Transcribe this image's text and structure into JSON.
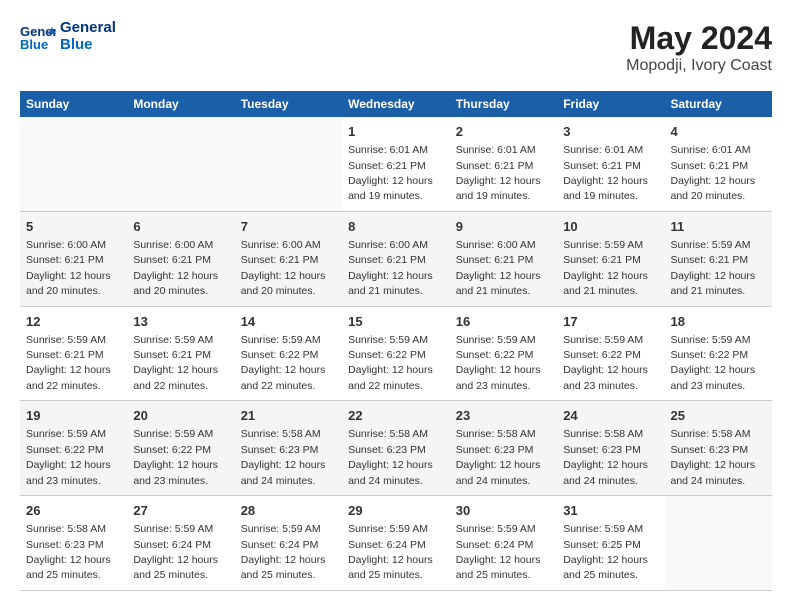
{
  "header": {
    "logo_line1": "General",
    "logo_line2": "Blue",
    "title": "May 2024",
    "subtitle": "Mopodji, Ivory Coast"
  },
  "days_of_week": [
    "Sunday",
    "Monday",
    "Tuesday",
    "Wednesday",
    "Thursday",
    "Friday",
    "Saturday"
  ],
  "weeks": [
    [
      {
        "day": "",
        "info": ""
      },
      {
        "day": "",
        "info": ""
      },
      {
        "day": "",
        "info": ""
      },
      {
        "day": "1",
        "info": "Sunrise: 6:01 AM\nSunset: 6:21 PM\nDaylight: 12 hours\nand 19 minutes."
      },
      {
        "day": "2",
        "info": "Sunrise: 6:01 AM\nSunset: 6:21 PM\nDaylight: 12 hours\nand 19 minutes."
      },
      {
        "day": "3",
        "info": "Sunrise: 6:01 AM\nSunset: 6:21 PM\nDaylight: 12 hours\nand 19 minutes."
      },
      {
        "day": "4",
        "info": "Sunrise: 6:01 AM\nSunset: 6:21 PM\nDaylight: 12 hours\nand 20 minutes."
      }
    ],
    [
      {
        "day": "5",
        "info": "Sunrise: 6:00 AM\nSunset: 6:21 PM\nDaylight: 12 hours\nand 20 minutes."
      },
      {
        "day": "6",
        "info": "Sunrise: 6:00 AM\nSunset: 6:21 PM\nDaylight: 12 hours\nand 20 minutes."
      },
      {
        "day": "7",
        "info": "Sunrise: 6:00 AM\nSunset: 6:21 PM\nDaylight: 12 hours\nand 20 minutes."
      },
      {
        "day": "8",
        "info": "Sunrise: 6:00 AM\nSunset: 6:21 PM\nDaylight: 12 hours\nand 21 minutes."
      },
      {
        "day": "9",
        "info": "Sunrise: 6:00 AM\nSunset: 6:21 PM\nDaylight: 12 hours\nand 21 minutes."
      },
      {
        "day": "10",
        "info": "Sunrise: 5:59 AM\nSunset: 6:21 PM\nDaylight: 12 hours\nand 21 minutes."
      },
      {
        "day": "11",
        "info": "Sunrise: 5:59 AM\nSunset: 6:21 PM\nDaylight: 12 hours\nand 21 minutes."
      }
    ],
    [
      {
        "day": "12",
        "info": "Sunrise: 5:59 AM\nSunset: 6:21 PM\nDaylight: 12 hours\nand 22 minutes."
      },
      {
        "day": "13",
        "info": "Sunrise: 5:59 AM\nSunset: 6:21 PM\nDaylight: 12 hours\nand 22 minutes."
      },
      {
        "day": "14",
        "info": "Sunrise: 5:59 AM\nSunset: 6:22 PM\nDaylight: 12 hours\nand 22 minutes."
      },
      {
        "day": "15",
        "info": "Sunrise: 5:59 AM\nSunset: 6:22 PM\nDaylight: 12 hours\nand 22 minutes."
      },
      {
        "day": "16",
        "info": "Sunrise: 5:59 AM\nSunset: 6:22 PM\nDaylight: 12 hours\nand 23 minutes."
      },
      {
        "day": "17",
        "info": "Sunrise: 5:59 AM\nSunset: 6:22 PM\nDaylight: 12 hours\nand 23 minutes."
      },
      {
        "day": "18",
        "info": "Sunrise: 5:59 AM\nSunset: 6:22 PM\nDaylight: 12 hours\nand 23 minutes."
      }
    ],
    [
      {
        "day": "19",
        "info": "Sunrise: 5:59 AM\nSunset: 6:22 PM\nDaylight: 12 hours\nand 23 minutes."
      },
      {
        "day": "20",
        "info": "Sunrise: 5:59 AM\nSunset: 6:22 PM\nDaylight: 12 hours\nand 23 minutes."
      },
      {
        "day": "21",
        "info": "Sunrise: 5:58 AM\nSunset: 6:23 PM\nDaylight: 12 hours\nand 24 minutes."
      },
      {
        "day": "22",
        "info": "Sunrise: 5:58 AM\nSunset: 6:23 PM\nDaylight: 12 hours\nand 24 minutes."
      },
      {
        "day": "23",
        "info": "Sunrise: 5:58 AM\nSunset: 6:23 PM\nDaylight: 12 hours\nand 24 minutes."
      },
      {
        "day": "24",
        "info": "Sunrise: 5:58 AM\nSunset: 6:23 PM\nDaylight: 12 hours\nand 24 minutes."
      },
      {
        "day": "25",
        "info": "Sunrise: 5:58 AM\nSunset: 6:23 PM\nDaylight: 12 hours\nand 24 minutes."
      }
    ],
    [
      {
        "day": "26",
        "info": "Sunrise: 5:58 AM\nSunset: 6:23 PM\nDaylight: 12 hours\nand 25 minutes."
      },
      {
        "day": "27",
        "info": "Sunrise: 5:59 AM\nSunset: 6:24 PM\nDaylight: 12 hours\nand 25 minutes."
      },
      {
        "day": "28",
        "info": "Sunrise: 5:59 AM\nSunset: 6:24 PM\nDaylight: 12 hours\nand 25 minutes."
      },
      {
        "day": "29",
        "info": "Sunrise: 5:59 AM\nSunset: 6:24 PM\nDaylight: 12 hours\nand 25 minutes."
      },
      {
        "day": "30",
        "info": "Sunrise: 5:59 AM\nSunset: 6:24 PM\nDaylight: 12 hours\nand 25 minutes."
      },
      {
        "day": "31",
        "info": "Sunrise: 5:59 AM\nSunset: 6:25 PM\nDaylight: 12 hours\nand 25 minutes."
      },
      {
        "day": "",
        "info": ""
      }
    ]
  ]
}
